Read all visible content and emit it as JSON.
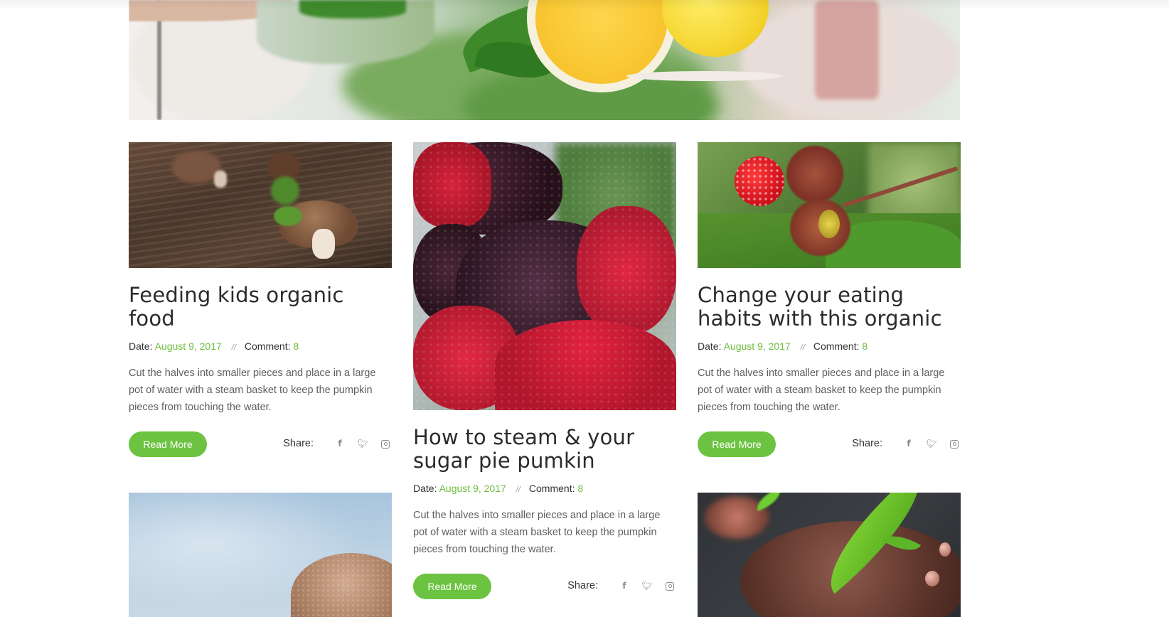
{
  "colors": {
    "accent": "#6cc341",
    "accent_text": "#6fbe3f",
    "title": "#2b2b2b",
    "body_text": "#5e5e5e"
  },
  "hero": {
    "image": "lemon-and-greens-photo"
  },
  "posts": [
    {
      "image": "mushroom-on-wood-photo",
      "title": "Feeding kids organic food",
      "date_label": "Date:",
      "date": "August 9, 2017",
      "separator": "//",
      "comment_label": "Comment:",
      "comment_count": "8",
      "excerpt": "Cut the halves into smaller pieces and place in a large pot of water with a steam basket to keep the pumpkin pieces from touching the water.",
      "read_more": "Read More",
      "share_label": "Share:",
      "share_icons": [
        "facebook-icon",
        "twitter-icon",
        "instagram-icon"
      ]
    },
    {
      "image": "mulberries-photo",
      "title": "How to steam & your sugar pie pumkin",
      "date_label": "Date:",
      "date": "August 9, 2017",
      "separator": "//",
      "comment_label": "Comment:",
      "comment_count": "8",
      "excerpt": "Cut the halves into smaller pieces and place in a large pot of water with a steam basket to keep the pumpkin pieces from touching the water.",
      "read_more": "Read More",
      "share_label": "Share:",
      "share_icons": [
        "facebook-icon",
        "twitter-icon",
        "instagram-icon"
      ]
    },
    {
      "image": "wild-raspberries-photo",
      "title": "Change your eating habits with this organic",
      "date_label": "Date:",
      "date": "August 9, 2017",
      "separator": "//",
      "comment_label": "Comment:",
      "comment_count": "8",
      "excerpt": "Cut the halves into smaller pieces and place in a large pot of water with a steam basket to keep the pumpkin pieces from touching the water.",
      "read_more": "Read More",
      "share_label": "Share:",
      "share_icons": [
        "facebook-icon",
        "twitter-icon",
        "instagram-icon"
      ]
    },
    {
      "image": "mushroom-sky-photo"
    },
    {
      "image": "leaf-on-stones-photo"
    }
  ]
}
